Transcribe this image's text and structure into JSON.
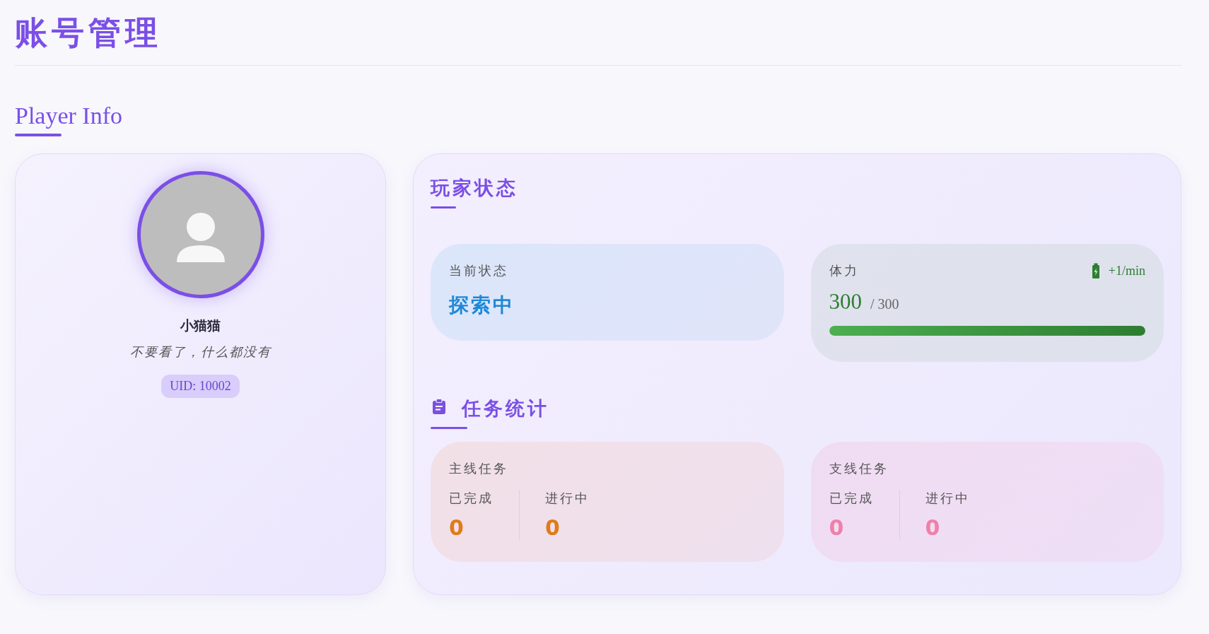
{
  "page_title": "账号管理",
  "section_title": "Player Info",
  "profile": {
    "name": "小猫猫",
    "motto": "不要看了，什么都没有",
    "uid": "UID: 10002"
  },
  "status_panel": {
    "title": "玩家状态",
    "current_state": {
      "label": "当前状态",
      "value": "探索中"
    },
    "stamina": {
      "label": "体力",
      "regen": "+1/min",
      "current": "300",
      "max": "/ 300",
      "level": 1.0
    }
  },
  "tasks": {
    "title": "任务统计",
    "groups": [
      {
        "title": "主线任务",
        "color": "#e07b1a",
        "stats": [
          {
            "label": "已完成",
            "value": "0"
          },
          {
            "label": "进行中",
            "value": "0"
          }
        ]
      },
      {
        "title": "支线任务",
        "color": "#f080a8",
        "stats": [
          {
            "label": "已完成",
            "value": "0"
          },
          {
            "label": "进行中",
            "value": "0"
          }
        ]
      }
    ]
  }
}
